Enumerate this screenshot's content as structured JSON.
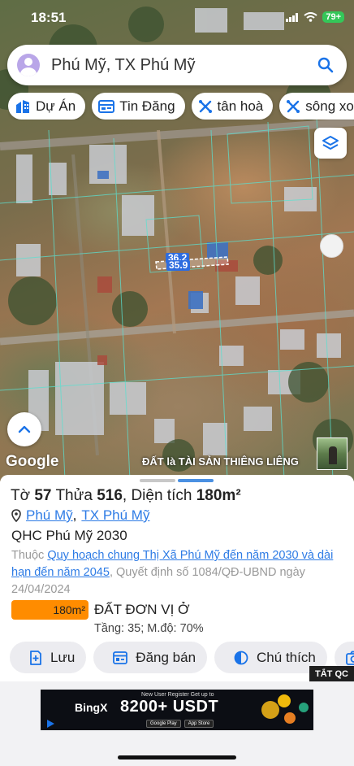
{
  "status_bar": {
    "time": "18:51",
    "battery": "79+"
  },
  "search": {
    "query": "Phú Mỹ, TX Phú Mỹ"
  },
  "chips": [
    {
      "label": "Dự Án",
      "icon": "building-icon"
    },
    {
      "label": "Tin Đăng",
      "icon": "listing-icon"
    },
    {
      "label": "tân hoà",
      "icon": "area-icon"
    },
    {
      "label": "sông xoài",
      "icon": "area-icon"
    }
  ],
  "map": {
    "dim_top": "36.2",
    "dim_bottom": "35.9",
    "attribution": "Google",
    "banner": "ĐẤT là TÀI SẢN THIÊNG LIÊNG"
  },
  "parcel": {
    "to_label": "Tờ",
    "to_value": "57",
    "thua_label": "Thửa",
    "thua_value": "516",
    "area_label": ", Diện tích",
    "area_value": "180m²",
    "ward": "Phú Mỹ",
    "separator": ",",
    "town": "TX Phú Mỹ"
  },
  "planning": {
    "name": "QHC Phú Mỹ 2030",
    "prefix": "Thuộc",
    "link": "Quy hoạch chung Thị Xã Phú Mỹ đến năm 2030 và dài hạn đến năm 2045",
    "decision": ", Quyết định số 1084/QĐ-UBND ngày 24/04/2024"
  },
  "land_use": {
    "area": "180m²",
    "type": "ĐẤT ĐƠN VỊ Ở",
    "stats": "Tầng: 35; M.độ: 70%",
    "color": "#ff8c00"
  },
  "actions": [
    {
      "label": "Lưu",
      "icon": "save-icon"
    },
    {
      "label": "Đăng bán",
      "icon": "post-sale-icon"
    },
    {
      "label": "Chú thích",
      "icon": "legend-icon"
    }
  ],
  "ad": {
    "close_label": "TẮT QC",
    "brand": "BingX",
    "headline_small": "New User Register Get up to",
    "headline": "8200+ USDT",
    "store_1": "Google Play",
    "store_2": "App Store"
  },
  "colors": {
    "link": "#2d7be5",
    "accent_blue": "#2d6cdf",
    "badge_orange": "#ff8c00"
  }
}
